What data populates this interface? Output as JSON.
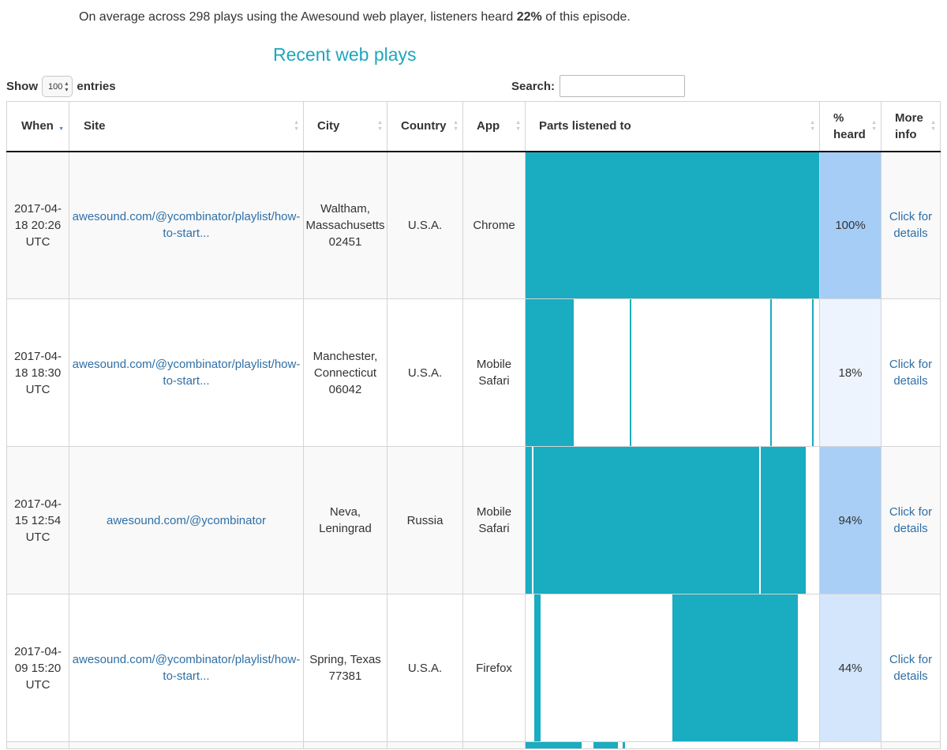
{
  "summary": {
    "prefix": "On average across 298 plays using the Awesound web player, listeners heard ",
    "percent": "22%",
    "suffix": " of this episode."
  },
  "heading": "Recent web plays",
  "show": {
    "label_before": "Show",
    "value": "100",
    "label_after": "entries"
  },
  "search": {
    "label": "Search:",
    "value": ""
  },
  "columns": [
    "When",
    "Site",
    "City",
    "Country",
    "App",
    "Parts listened to",
    "% heard",
    "More info"
  ],
  "rows": [
    {
      "when": "2017-04-18 20:26 UTC",
      "site": "awesound.com/@ycombinator/playlist/how-to-start...",
      "city": "Waltham, Massachusetts 02451",
      "country": "U.S.A.",
      "app": "Chrome",
      "parts": [
        [
          0.0,
          1.0
        ]
      ],
      "heard": "100%",
      "heard_fraction": 1.0,
      "heard_color": "#a6cdf5",
      "more": "Click for details"
    },
    {
      "when": "2017-04-18 18:30 UTC",
      "site": "awesound.com/@ycombinator/playlist/how-to-start...",
      "city": "Manchester, Connecticut 06042",
      "country": "U.S.A.",
      "app": "Mobile Safari",
      "parts": [
        [
          0.0,
          0.165
        ],
        [
          0.355,
          0.36
        ],
        [
          0.834,
          0.839
        ],
        [
          0.975,
          0.98
        ]
      ],
      "heard": "18%",
      "heard_fraction": 0.18,
      "heard_color": "#edf4fd",
      "more": "Click for details"
    },
    {
      "when": "2017-04-15 12:54 UTC",
      "site": "awesound.com/@ycombinator",
      "city": "Neva, Leningrad",
      "country": "Russia",
      "app": "Mobile Safari",
      "parts": [
        [
          0.0,
          0.021
        ],
        [
          0.027,
          0.796
        ],
        [
          0.802,
          0.955
        ]
      ],
      "heard": "94%",
      "heard_fraction": 0.94,
      "heard_color": "#aacff6",
      "more": "Click for details"
    },
    {
      "when": "2017-04-09 15:20 UTC",
      "site": "awesound.com/@ycombinator/playlist/how-to-start...",
      "city": "Spring, Texas 77381",
      "country": "U.S.A.",
      "app": "Firefox",
      "parts": [
        [
          0.03,
          0.051
        ],
        [
          0.5,
          0.927
        ]
      ],
      "heard": "44%",
      "heard_fraction": 0.44,
      "heard_color": "#d4e6fb",
      "more": "Click for details"
    },
    {
      "when": "",
      "site": "",
      "city": "",
      "country": "",
      "app": "",
      "parts": [
        [
          0.0,
          0.19
        ],
        [
          0.23,
          0.315
        ],
        [
          0.33,
          0.34
        ]
      ],
      "heard": "",
      "heard_fraction": null,
      "heard_color": "#ffffff",
      "more": ""
    }
  ]
}
